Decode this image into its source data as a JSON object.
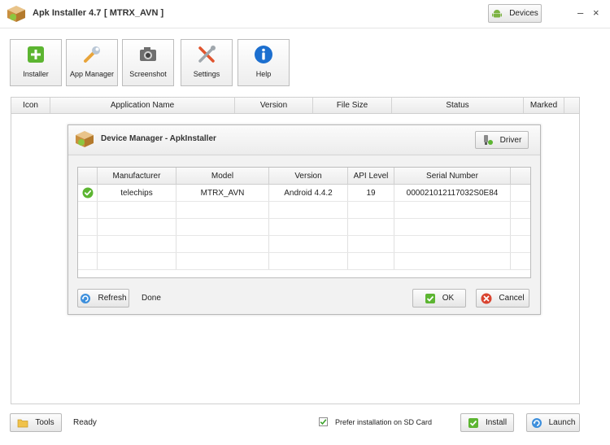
{
  "window": {
    "title": "Apk Installer 4.7",
    "device": "[ MTRX_AVN ]",
    "devices_label": "Devices",
    "minimize": "–",
    "close": "×"
  },
  "toolbar": {
    "installer": "Installer",
    "app_manager": "App Manager",
    "screenshot": "Screenshot",
    "settings": "Settings",
    "help": "Help"
  },
  "app_table": {
    "columns": [
      "Icon",
      "Application Name",
      "Version",
      "File Size",
      "Status",
      "Marked"
    ]
  },
  "device_dialog": {
    "title": "Device Manager - ApkInstaller",
    "driver_label": "Driver",
    "columns": [
      "",
      "Manufacturer",
      "Model",
      "Version",
      "API Level",
      "Serial Number"
    ],
    "rows": [
      {
        "status_icon": "check-circle-icon",
        "manufacturer": "telechips",
        "model": "MTRX_AVN",
        "version": "Android 4.4.2",
        "api_level": "19",
        "serial": "000021012117032S0E84"
      }
    ],
    "refresh_label": "Refresh",
    "status": "Done",
    "ok_label": "OK",
    "cancel_label": "Cancel"
  },
  "footer": {
    "tools_label": "Tools",
    "status": "Ready",
    "prefer_sd_label": "Prefer installation on SD Card",
    "prefer_sd_checked": true,
    "install_label": "Install",
    "launch_label": "Launch"
  },
  "colors": {
    "accent_green": "#5cb531",
    "cancel_red": "#d9432f",
    "help_blue": "#1c6fcf"
  }
}
